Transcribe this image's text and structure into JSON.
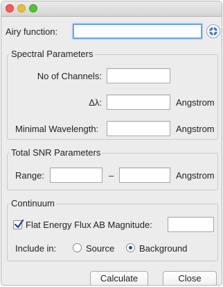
{
  "window": {
    "controls": [
      "close",
      "minimize",
      "maximize"
    ]
  },
  "airy": {
    "label": "Airy function:",
    "value": "",
    "help_icon": "help-lifebuoy-icon"
  },
  "spectral": {
    "title": "Spectral Parameters",
    "channels_label": "No of Channels:",
    "channels_value": "",
    "delta_label": "Δλ:",
    "delta_value": "",
    "delta_unit": "Angstrom",
    "minwl_label": "Minimal Wavelength:",
    "minwl_value": "",
    "minwl_unit": "Angstrom"
  },
  "snr": {
    "title": "Total SNR Parameters",
    "range_label": "Range:",
    "range_from": "",
    "dash": "–",
    "range_to": "",
    "unit": "Angstrom"
  },
  "continuum": {
    "title": "Continuum",
    "flat_label": "Flat Energy Flux AB Magnitude:",
    "flat_checked": true,
    "flat_value": "",
    "include_label": "Include in:",
    "source_label": "Source",
    "background_label": "Background",
    "selected": "Background"
  },
  "buttons": {
    "calculate": "Calculate",
    "close": "Close"
  }
}
